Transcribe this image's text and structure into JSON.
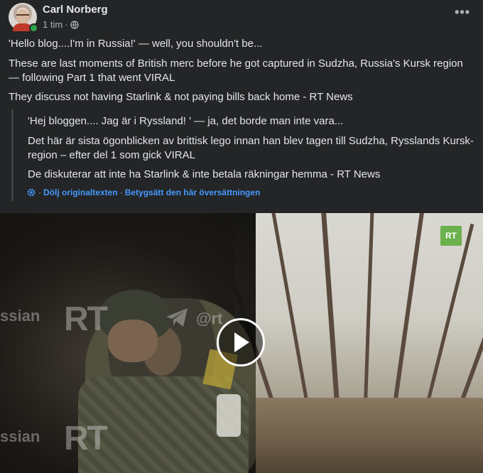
{
  "post": {
    "author": "Carl Norberg",
    "time": "1 tim",
    "meta_separator": "·",
    "icons": {
      "audience": "globe-icon",
      "more": "more-options-icon",
      "translate": "gear-icon"
    }
  },
  "original": {
    "line1": "'Hello blog....I'm in Russia!' — well, you shouldn't be...",
    "line2": "These are last moments of British merc before he got captured in Sudzha, Russia's Kursk region — following Part 1 that went VIRAL",
    "line3": "They discuss not having Starlink & not paying bills back home - RT News"
  },
  "translation": {
    "line1": "'Hej bloggen.... Jag är i Ryssland! ' — ja, det borde man inte vara...",
    "line2": "Det här är sista ögonblicken av brittisk lego innan han blev tagen till Sudzha, Rysslands Kursk-region – efter del 1 som gick VIRAL",
    "line3": "De diskuterar att inte ha Starlink & inte betala räkningar hemma - RT News",
    "hide_original": "Dölj originaltexten",
    "rate": "Betygsätt den här översättningen",
    "dot": "·"
  },
  "video": {
    "logo": "RT",
    "watermark_main": "RT",
    "watermark_handle": "@rt_",
    "watermark_side": "ssian",
    "watermark_side2": "ssian",
    "watermark_rt2": "RT",
    "colors": {
      "logo_bg": "#6ab04c"
    }
  }
}
